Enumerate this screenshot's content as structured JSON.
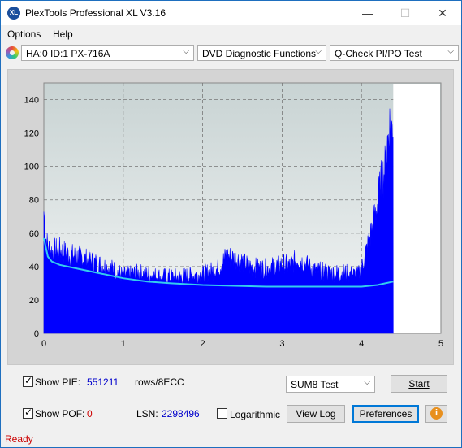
{
  "window": {
    "title": "PlexTools Professional XL V3.16",
    "minimize": "—",
    "maximize": "☐",
    "close": "✕",
    "app_icon": "XL"
  },
  "menu": {
    "options": "Options",
    "help": "Help"
  },
  "toolbar": {
    "drive": "HA:0 ID:1  PX-716A",
    "function": "DVD Diagnostic Functions",
    "test": "Q-Check PI/PO Test"
  },
  "chart_data": {
    "type": "area",
    "x_ticks": [
      "0",
      "1",
      "2",
      "3",
      "4",
      "5"
    ],
    "y_ticks": [
      "0",
      "20",
      "40",
      "60",
      "80",
      "100",
      "120",
      "140"
    ],
    "xlim": [
      0,
      5
    ],
    "ylim": [
      0,
      150
    ],
    "grid": true,
    "colors": {
      "pie": "#0000ff",
      "avg": "#33ccee",
      "plot_bg_top": "#c8d3d3",
      "plot_bg_bottom": "#f4f6f6"
    },
    "data_end_x": 4.4,
    "pie_peaks": {
      "x": [
        0,
        0.02,
        0.05,
        0.1,
        0.2,
        0.3,
        0.5,
        0.7,
        0.9,
        1.0,
        1.2,
        1.4,
        1.6,
        1.8,
        2.0,
        2.2,
        2.3,
        2.4,
        2.5,
        2.6,
        2.8,
        3.0,
        3.1,
        3.2,
        3.4,
        3.6,
        3.8,
        3.95,
        4.0,
        4.1,
        4.15,
        4.2,
        4.25,
        4.3,
        4.33,
        4.35,
        4.38,
        4.4
      ],
      "y": [
        85,
        68,
        60,
        57,
        58,
        55,
        52,
        48,
        44,
        40,
        42,
        40,
        39,
        40,
        41,
        45,
        54,
        52,
        50,
        46,
        45,
        48,
        47,
        52,
        44,
        42,
        42,
        40,
        45,
        65,
        78,
        90,
        105,
        115,
        135,
        145,
        140,
        150
      ]
    },
    "pie_avg": {
      "x": [
        0,
        0.05,
        0.1,
        0.2,
        0.3,
        0.5,
        0.7,
        1.0,
        1.3,
        1.6,
        2.0,
        2.4,
        2.8,
        3.2,
        3.6,
        3.9,
        4.0,
        4.1,
        4.2,
        4.3,
        4.4
      ],
      "y": [
        57,
        46,
        43,
        41,
        40,
        38,
        36,
        33,
        31,
        30,
        29,
        28.5,
        28,
        28,
        28,
        28,
        28,
        28.5,
        29,
        30,
        31
      ]
    }
  },
  "controls": {
    "show_pie_label": "Show PIE:",
    "pie_value": "551211",
    "pie_unit": "rows/8ECC",
    "show_pof_label": "Show POF:",
    "pof_value": "0",
    "lsn_label": "LSN:",
    "lsn_value": "2298496",
    "logarithmic_label": "Logarithmic",
    "sum_test": "SUM8 Test",
    "start": "Start",
    "view_log": "View Log",
    "preferences": "Preferences",
    "info_icon": "i",
    "show_pie_checked": true,
    "show_pof_checked": true,
    "logarithmic_checked": false
  },
  "status": {
    "text": "Ready"
  }
}
